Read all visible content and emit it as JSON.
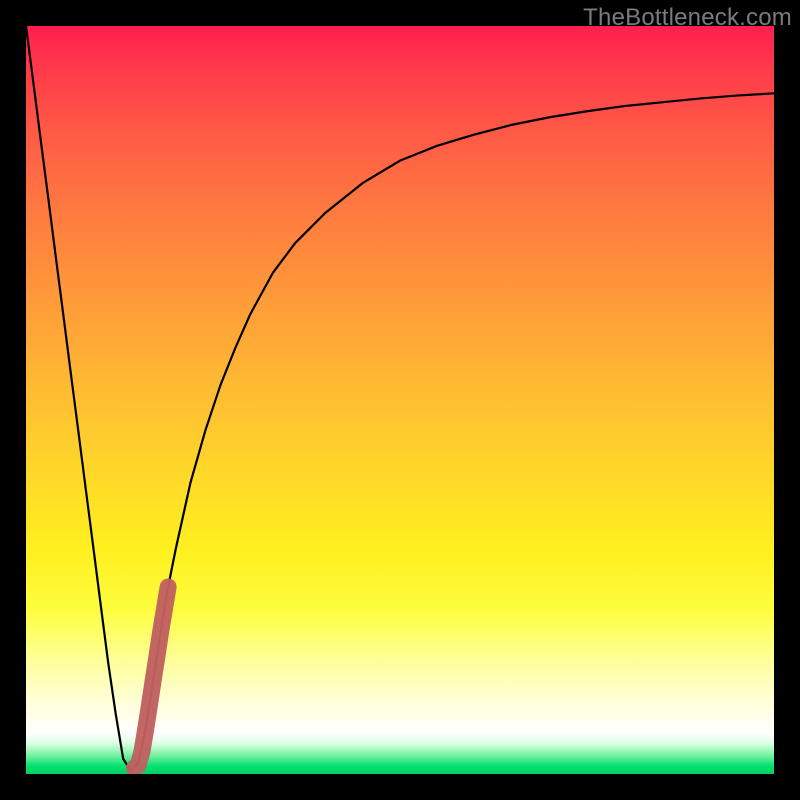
{
  "watermark": "TheBottleneck.com",
  "chart_data": {
    "type": "line",
    "title": "",
    "xlabel": "",
    "ylabel": "",
    "xlim": [
      0,
      100
    ],
    "ylim": [
      0,
      100
    ],
    "grid": false,
    "legend": false,
    "series": [
      {
        "name": "bottleneck-curve",
        "x": [
          0,
          1,
          2,
          3,
          4,
          5,
          6,
          7,
          8,
          9,
          10,
          11,
          12,
          13,
          14,
          15,
          16,
          17,
          18,
          19,
          20,
          22,
          24,
          26,
          28,
          30,
          33,
          36,
          40,
          45,
          50,
          55,
          60,
          65,
          70,
          75,
          80,
          85,
          90,
          95,
          100
        ],
        "values": [
          100,
          92.3,
          84.5,
          76.8,
          69.0,
          61.3,
          53.5,
          45.8,
          38.0,
          30.3,
          22.5,
          14.8,
          8.0,
          2.0,
          0.5,
          1.5,
          6.0,
          12.5,
          19.0,
          25.0,
          30.0,
          39.0,
          46.0,
          52.0,
          57.0,
          61.5,
          67.0,
          71.0,
          75.0,
          79.0,
          82.0,
          84.0,
          85.5,
          86.8,
          87.8,
          88.6,
          89.3,
          89.8,
          90.3,
          90.7,
          91.0
        ]
      }
    ],
    "marker": {
      "x": [
        14.5,
        15.0,
        15.5,
        16.0,
        16.5,
        17.0,
        17.5,
        18.0,
        18.5,
        19.0
      ],
      "values": [
        0.8,
        1.2,
        3.0,
        6.0,
        9.2,
        12.5,
        15.7,
        19.0,
        22.0,
        25.0
      ],
      "color": "#c06060"
    },
    "background": {
      "type": "vertical-gradient",
      "stops": [
        {
          "pos": 0,
          "color": "#ff1f4f"
        },
        {
          "pos": 35,
          "color": "#ff963a"
        },
        {
          "pos": 70,
          "color": "#fff01f"
        },
        {
          "pos": 94,
          "color": "#ffffff"
        },
        {
          "pos": 100,
          "color": "#00d060"
        }
      ]
    }
  }
}
